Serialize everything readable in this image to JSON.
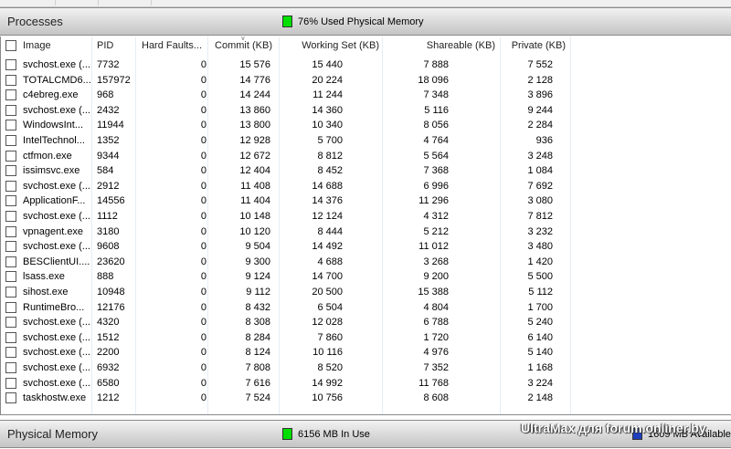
{
  "processes_panel": {
    "title": "Processes",
    "legend": "76% Used Physical Memory",
    "legend_color": "#00e000"
  },
  "columns": [
    "Image",
    "PID",
    "Hard Faults...",
    "Commit (KB)",
    "Working Set (KB)",
    "Shareable (KB)",
    "Private (KB)"
  ],
  "rows": [
    [
      "svchost.exe (...",
      "7732",
      "0",
      "15 576",
      "15 440",
      "7 888",
      "7 552"
    ],
    [
      "TOTALCMD6...",
      "157972",
      "0",
      "14 776",
      "20 224",
      "18 096",
      "2 128"
    ],
    [
      "c4ebreg.exe",
      "968",
      "0",
      "14 244",
      "11 244",
      "7 348",
      "3 896"
    ],
    [
      "svchost.exe (...",
      "2432",
      "0",
      "13 860",
      "14 360",
      "5 116",
      "9 244"
    ],
    [
      "WindowsInt...",
      "11944",
      "0",
      "13 800",
      "10 340",
      "8 056",
      "2 284"
    ],
    [
      "IntelTechnol...",
      "1352",
      "0",
      "12 928",
      "5 700",
      "4 764",
      "936"
    ],
    [
      "ctfmon.exe",
      "9344",
      "0",
      "12 672",
      "8 812",
      "5 564",
      "3 248"
    ],
    [
      "issimsvc.exe",
      "584",
      "0",
      "12 404",
      "8 452",
      "7 368",
      "1 084"
    ],
    [
      "svchost.exe (...",
      "2912",
      "0",
      "11 408",
      "14 688",
      "6 996",
      "7 692"
    ],
    [
      "ApplicationF...",
      "14556",
      "0",
      "11 404",
      "14 376",
      "11 296",
      "3 080"
    ],
    [
      "svchost.exe (...",
      "1112",
      "0",
      "10 148",
      "12 124",
      "4 312",
      "7 812"
    ],
    [
      "vpnagent.exe",
      "3180",
      "0",
      "10 120",
      "8 444",
      "5 212",
      "3 232"
    ],
    [
      "svchost.exe (...",
      "9608",
      "0",
      "9 504",
      "14 492",
      "11 012",
      "3 480"
    ],
    [
      "BESClientUI....",
      "23620",
      "0",
      "9 300",
      "4 688",
      "3 268",
      "1 420"
    ],
    [
      "lsass.exe",
      "888",
      "0",
      "9 124",
      "14 700",
      "9 200",
      "5 500"
    ],
    [
      "sihost.exe",
      "10948",
      "0",
      "9 112",
      "20 500",
      "15 388",
      "5 112"
    ],
    [
      "RuntimeBro...",
      "12176",
      "0",
      "8 432",
      "6 504",
      "4 804",
      "1 700"
    ],
    [
      "svchost.exe (...",
      "4320",
      "0",
      "8 308",
      "12 028",
      "6 788",
      "5 240"
    ],
    [
      "svchost.exe (...",
      "1512",
      "0",
      "8 284",
      "7 860",
      "1 720",
      "6 140"
    ],
    [
      "svchost.exe (...",
      "2200",
      "0",
      "8 124",
      "10 116",
      "4 976",
      "5 140"
    ],
    [
      "svchost.exe (...",
      "6932",
      "0",
      "7 808",
      "8 520",
      "7 352",
      "1 168"
    ],
    [
      "svchost.exe (...",
      "6580",
      "0",
      "7 616",
      "14 992",
      "11 768",
      "3 224"
    ],
    [
      "taskhostw.exe",
      "1212",
      "0",
      "7 524",
      "10 756",
      "8 608",
      "2 148"
    ]
  ],
  "memory_panel": {
    "title": "Physical Memory",
    "in_use": "6156 MB In Use",
    "in_use_color": "#00e000",
    "available": "1609 MB Available",
    "available_color": "#1e3fbf"
  },
  "watermark": "UltraMax для forum.onliner.by"
}
